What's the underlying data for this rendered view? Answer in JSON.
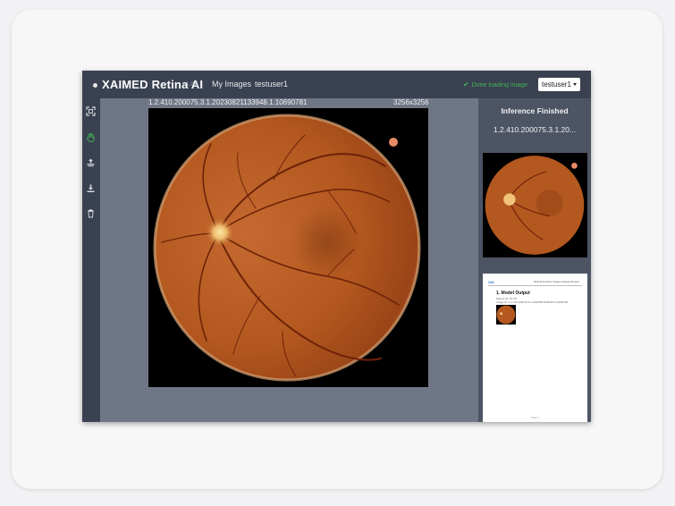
{
  "header": {
    "brand": "XAIMED Retina AI",
    "version": "v1.0.0",
    "nav": [
      "My Images",
      "testuser1"
    ],
    "status": "Done loading image",
    "user_menu": "testuser1"
  },
  "sidebar": {
    "icons": [
      "fit-screen-icon",
      "pan-hand-icon",
      "upload-icon",
      "download-icon",
      "trash-icon"
    ]
  },
  "viewer": {
    "image_id": "1.2.410.200075.3.1.20230821133948.1.10690781",
    "image_size": "3256x3256"
  },
  "panel": {
    "title": "Inference Finished",
    "image_id_short": "1.2.410.200075.3.1.20...",
    "report": {
      "logo": "XAI",
      "heading": "Retinal Fundus Image Analysis Report",
      "section": "1. Model Output",
      "line1": "Patient ID: 1P 45",
      "line2": "Image ID: 1.2.410.200075.3.1.20230821133948.1.10690781",
      "page": "Page 1"
    }
  },
  "colors": {
    "header_bg": "#3a4150",
    "canvas_bg": "#6f7685",
    "panel_bg": "#4d5565",
    "status_green": "#41b45a",
    "fundus_orange": "#c0652c"
  }
}
